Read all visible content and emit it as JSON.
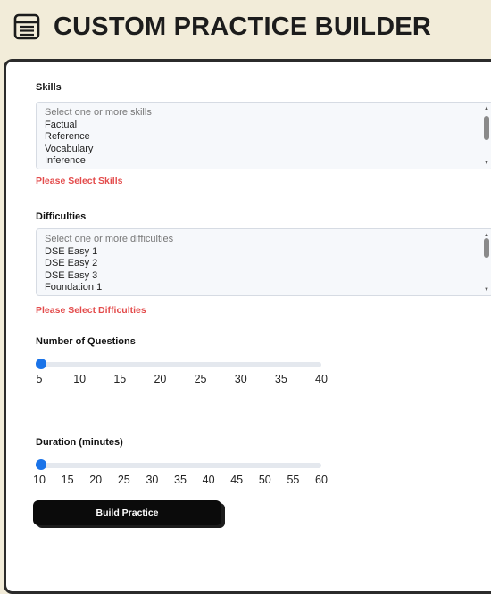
{
  "header": {
    "title": "CUSTOM PRACTICE BUILDER",
    "icon": "notebook-icon"
  },
  "skills": {
    "label": "Skills",
    "placeholder": "Select one or more skills",
    "options": [
      "Factual",
      "Reference",
      "Vocabulary",
      "Inference"
    ],
    "error": "Please Select Skills"
  },
  "difficulties": {
    "label": "Difficulties",
    "placeholder": "Select one or more difficulties",
    "options": [
      "DSE Easy 1",
      "DSE Easy 2",
      "DSE Easy 3",
      "Foundation 1"
    ],
    "error": "Please Select Difficulties"
  },
  "questions": {
    "label": "Number of Questions",
    "value": 5,
    "ticks": [
      "5",
      "10",
      "15",
      "20",
      "25",
      "30",
      "35",
      "40"
    ]
  },
  "duration": {
    "label": "Duration (minutes)",
    "value": 10,
    "ticks": [
      "10",
      "15",
      "20",
      "25",
      "30",
      "35",
      "40",
      "45",
      "50",
      "55",
      "60"
    ]
  },
  "build_button": "Build Practice",
  "colors": {
    "accent": "#1a73e8",
    "error": "#e34b4b",
    "background": "#f2ecd9"
  }
}
